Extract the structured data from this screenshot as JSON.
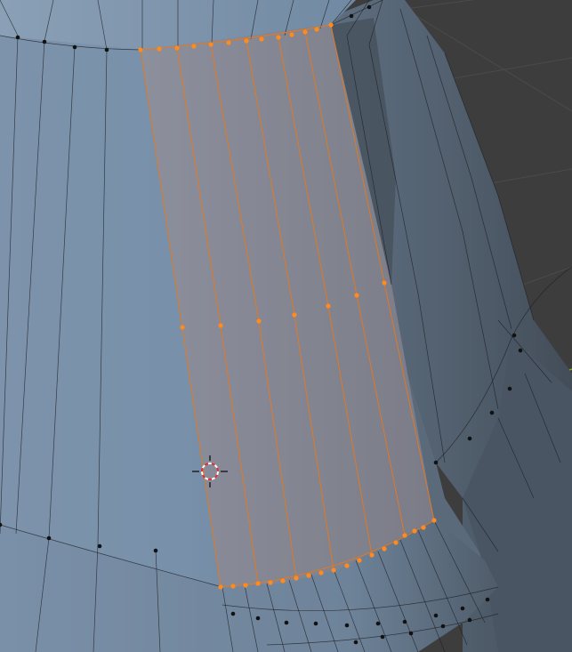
{
  "viewport": {
    "mode": "Edit Mode",
    "select_mode": "vertex",
    "background_color": "#3d3d3d",
    "grid_line_color": "#4c4c4c",
    "axis_y_color": "#7fa83a"
  },
  "mesh": {
    "face_color_light": "#7d94ad",
    "face_color_dark": "#4e5b69",
    "edge_color": "#1c1e22",
    "vertex_color": "#111111",
    "selection": {
      "face_color": "#8a8a94",
      "edge_color": "#e8781a",
      "vertex_color": "#ff8a1f"
    }
  },
  "cursor_3d": {
    "icon": "3d-cursor-icon",
    "ring_colors": [
      "#ffffff",
      "#e03030"
    ]
  }
}
